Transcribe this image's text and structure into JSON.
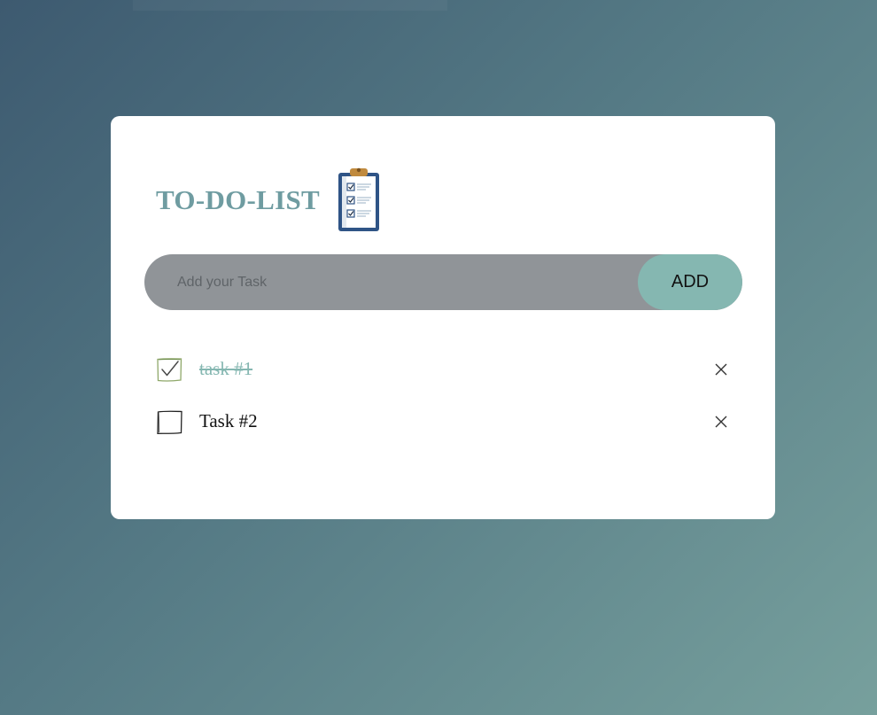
{
  "app": {
    "title": "TO-DO-LIST",
    "title_icon": "clipboard-checklist-icon"
  },
  "input": {
    "placeholder": "Add your Task",
    "value": ""
  },
  "add_button": {
    "label": "ADD"
  },
  "tasks": [
    {
      "text": "task #1",
      "completed": true
    },
    {
      "text": "Task #2",
      "completed": false
    }
  ],
  "colors": {
    "accent": "#85b7b1",
    "title": "#6f9ca1",
    "input_bg": "#909498",
    "card_bg": "#ffffff"
  }
}
